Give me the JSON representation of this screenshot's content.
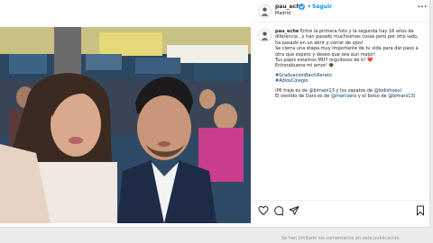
{
  "post": {
    "username": "pau_eche",
    "follow_label": "Seguir",
    "separator": "•",
    "location": "Madrid",
    "more_icon": "more-horizontal-icon",
    "verified_icon": "verified-badge-icon"
  },
  "caption": {
    "username": "pau_eche",
    "line1_text": " Entre la primera foto y la segunda hay 16 años de",
    "line2": "diferencia...y han pasado muchísimas cosas pero por otro lado,",
    "line3": "ha pasado en un abrir y cerrar de ojos!",
    "line4": "Se cierra una etapa muy importante de tu vida para dar paso a",
    "line5": "otra que espero y deseo que sea aun mejor!",
    "line6": "Tus papis estamos MUY orgullosos de ti! ❤️",
    "line7": "Enhorabuena mi amor! 🎓",
    "hashtag1": "#GraduaciónBachillerato",
    "hashtag2": "#AdiósColegio",
    "credits1_a": "(Mi traje es de ",
    "credits1_tag1": "@bimani13",
    "credits1_b": " y los zapatos de ",
    "credits1_tag2": "@lodishoes",
    "credits1_c": ")",
    "credits2_a": "El vestido de Dani es de ",
    "credits2_tag1": "@marciano",
    "credits2_b": " y el bolso de ",
    "credits2_tag2": "@bimani13",
    "credits2_c": ")"
  },
  "actions": [
    {
      "name": "like",
      "icon": "heart-icon"
    },
    {
      "name": "comment",
      "icon": "comment-icon"
    },
    {
      "name": "share",
      "icon": "share-icon"
    },
    {
      "name": "save",
      "icon": "bookmark-icon"
    }
  ],
  "footer": {
    "comments_notice": "Se han limitado los comentarios en esta publicación."
  }
}
